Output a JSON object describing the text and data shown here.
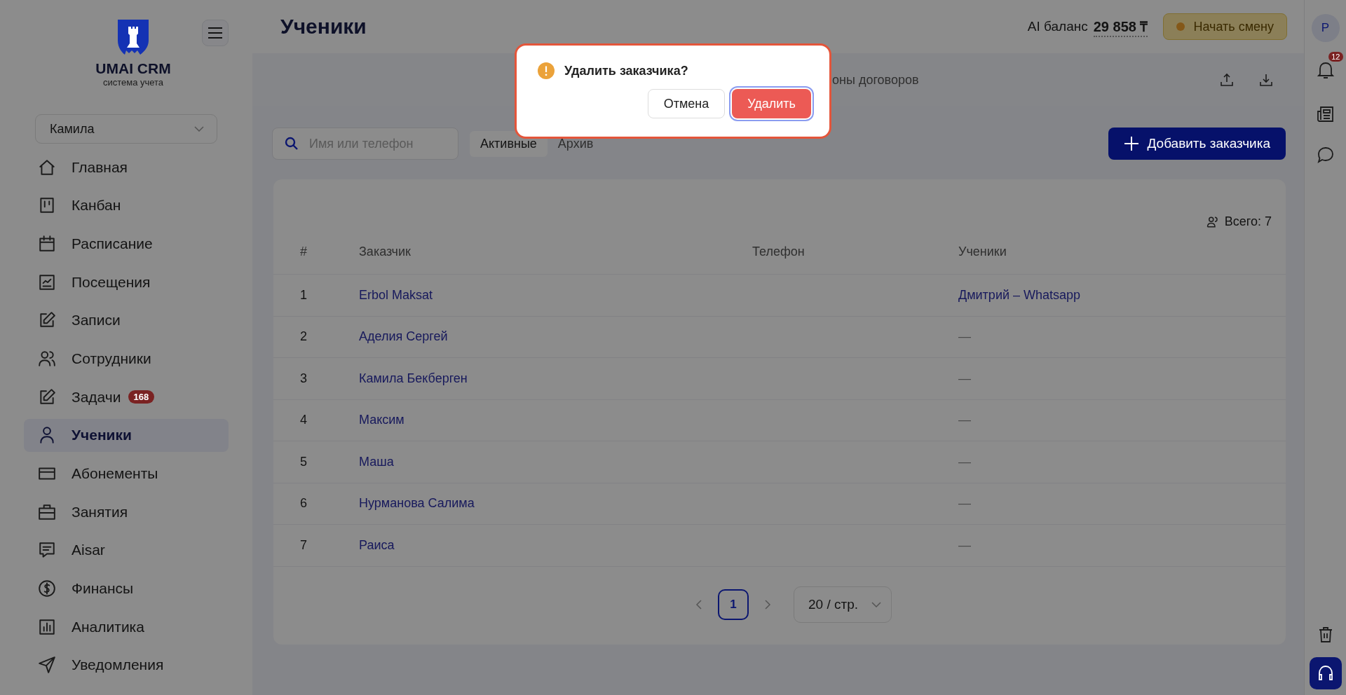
{
  "sidebar": {
    "logo": {
      "title": "UMAI CRM",
      "subtitle": "система учета"
    },
    "user_select": {
      "value": "Камила"
    },
    "items": [
      {
        "label": "Главная",
        "selected": false
      },
      {
        "label": "Канбан",
        "selected": false
      },
      {
        "label": "Расписание",
        "selected": false
      },
      {
        "label": "Посещения",
        "selected": false
      },
      {
        "label": "Записи",
        "selected": false
      },
      {
        "label": "Сотрудники",
        "selected": false
      },
      {
        "label": "Задачи",
        "selected": false,
        "badge": "168"
      },
      {
        "label": "Ученики",
        "selected": true
      },
      {
        "label": "Абонементы",
        "selected": false
      },
      {
        "label": "Занятия",
        "selected": false
      },
      {
        "label": "Aisar",
        "selected": false
      },
      {
        "label": "Финансы",
        "selected": false
      },
      {
        "label": "Аналитика",
        "selected": false
      },
      {
        "label": "Уведомления",
        "selected": false
      }
    ]
  },
  "header": {
    "title": "Ученики",
    "ai_balance": {
      "label": "AI баланс",
      "value": "29 858 ₸"
    },
    "shift_button": {
      "label": "Начать смену"
    }
  },
  "tabs": {
    "visible_fragment": "оны договоров"
  },
  "toolbar": {
    "search": {
      "placeholder": "Имя или телефон"
    },
    "filters": [
      {
        "label": "Активные",
        "selected": true
      },
      {
        "label": "Архив",
        "selected": false
      }
    ],
    "add_button": {
      "label": "Добавить заказчика"
    }
  },
  "table": {
    "total": "Всего: 7",
    "columns": [
      "#",
      "Заказчик",
      "Телефон",
      "Ученики"
    ],
    "rows": [
      {
        "number": "1",
        "customer": "Erbol Maksat",
        "students": "Дмитрий – Whatsapp",
        "students_link": true
      },
      {
        "number": "2",
        "customer": "Аделия Сергей",
        "students": "—",
        "students_link": false
      },
      {
        "number": "3",
        "customer": "Камила Бекберген",
        "students": "—",
        "students_link": false
      },
      {
        "number": "4",
        "customer": "Максим",
        "students": "—",
        "students_link": false
      },
      {
        "number": "5",
        "customer": "Маша",
        "students": "—",
        "students_link": false
      },
      {
        "number": "6",
        "customer": "Нурманова Салима",
        "students": "—",
        "students_link": false
      },
      {
        "number": "7",
        "customer": "Раиса",
        "students": "—",
        "students_link": false
      }
    ]
  },
  "pagination": {
    "pages": [
      {
        "label": "1",
        "selected": true
      }
    ],
    "page_size": "20 / стр."
  },
  "right_bar": {
    "avatar": "Р",
    "notifications_badge": "12"
  },
  "dialog": {
    "title": "Удалить заказчика?",
    "buttons": [
      {
        "label": "Отмена",
        "kind": "cancel"
      },
      {
        "label": "Удалить",
        "kind": "danger"
      }
    ]
  }
}
